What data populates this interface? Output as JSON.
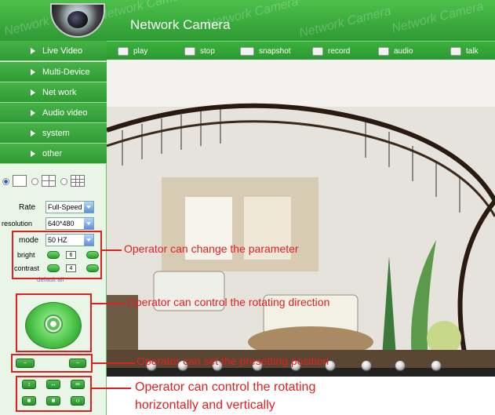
{
  "header": {
    "title": "Network Camera",
    "watermark": "Network Camera"
  },
  "sidebar": {
    "nav": [
      {
        "label": "Live Video",
        "icon": "triangle-right-icon"
      },
      {
        "label": "Multi-Device",
        "icon": "triangle-right-icon"
      },
      {
        "label": "Net work",
        "icon": "triangle-right-icon"
      },
      {
        "label": "Audio video",
        "icon": "triangle-right-icon"
      },
      {
        "label": "system",
        "icon": "triangle-right-icon"
      },
      {
        "label": "other",
        "icon": "triangle-right-icon"
      }
    ],
    "params": {
      "rate_label": "Rate",
      "rate_value": "Full-Speed",
      "resolution_label": "resolution",
      "resolution_value": "640*480",
      "mode_label": "mode",
      "mode_value": "50 HZ",
      "bright_label": "bright",
      "bright_value": "6",
      "contrast_label": "contrast",
      "contrast_value": "4",
      "default_all": "default all"
    },
    "rotation_icons": [
      "vertical-rotate-icon",
      "horizontal-rotate-icon",
      "loop-rotate-icon",
      "stop-icon",
      "stop-icon",
      "reverse-icon"
    ]
  },
  "toolbar": {
    "items": [
      {
        "label": "play",
        "icon": "play-icon"
      },
      {
        "label": "stop",
        "icon": "stop-icon"
      },
      {
        "label": "snapshot",
        "icon": "camera-icon"
      },
      {
        "label": "record",
        "icon": "record-icon"
      },
      {
        "label": "audio",
        "icon": "headphones-icon"
      },
      {
        "label": "talk",
        "icon": "microphone-icon"
      }
    ]
  },
  "annotations": {
    "parameter": "Operator can change the parameter",
    "rotating_direction": "Operator can control the rotating direction",
    "presetting": "Operator can set the presetting position",
    "rotating_hv_line1": "Operator can control the rotating",
    "rotating_hv_line2": "horizontally and vertically"
  },
  "colors": {
    "brand_green": "#33a63a",
    "annotation_red": "#e02020"
  }
}
